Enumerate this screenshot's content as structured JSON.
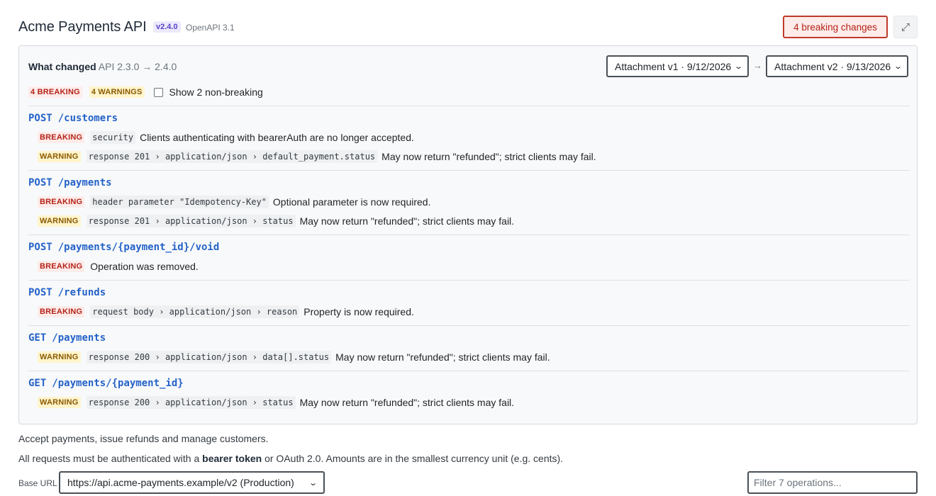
{
  "header": {
    "title": "Acme Payments API",
    "version": "v2.4.0",
    "spec": "OpenAPI 3.1",
    "breaking_button": "4 breaking changes",
    "expand_icon": "expand-icon"
  },
  "diff": {
    "label": "What changed",
    "range": "API 2.3.0 → 2.4.0",
    "attachment_left": "Attachment v1 · 9/12/2026",
    "attachment_right": "Attachment v2 · 9/13/2026",
    "arrow": "→",
    "breaking_count": "4 BREAKING",
    "warning_count": "4 WARNINGS",
    "show_nonbreaking": "Show 2 non-breaking",
    "show_nonbreaking_checked": false,
    "operations": [
      {
        "method": "POST",
        "path": "/customers",
        "changes": [
          {
            "level": "BREAKING",
            "location": "security",
            "text": "Clients authenticating with bearerAuth are no longer accepted."
          },
          {
            "level": "WARNING",
            "location": "response 201 › application/json › default_payment.status",
            "text": "May now return \"refunded\"; strict clients may fail."
          }
        ]
      },
      {
        "method": "POST",
        "path": "/payments",
        "changes": [
          {
            "level": "BREAKING",
            "location": "header parameter \"Idempotency-Key\"",
            "text": "Optional parameter is now required."
          },
          {
            "level": "WARNING",
            "location": "response 201 › application/json › status",
            "text": "May now return \"refunded\"; strict clients may fail."
          }
        ]
      },
      {
        "method": "POST",
        "path": "/payments/{payment_id}/void",
        "changes": [
          {
            "level": "BREAKING",
            "location": "",
            "text": "Operation was removed."
          }
        ]
      },
      {
        "method": "POST",
        "path": "/refunds",
        "changes": [
          {
            "level": "BREAKING",
            "location": "request body › application/json › reason",
            "text": "Property is now required."
          }
        ]
      },
      {
        "method": "GET",
        "path": "/payments",
        "changes": [
          {
            "level": "WARNING",
            "location": "response 200 › application/json › data[].status",
            "text": "May now return \"refunded\"; strict clients may fail."
          }
        ]
      },
      {
        "method": "GET",
        "path": "/payments/{payment_id}",
        "changes": [
          {
            "level": "WARNING",
            "location": "response 200 › application/json › status",
            "text": "May now return \"refunded\"; strict clients may fail."
          }
        ]
      }
    ]
  },
  "info": {
    "summary": "Accept payments, issue refunds and manage customers.",
    "auth_prefix": "All requests must be authenticated with a ",
    "auth_bold": "bearer token",
    "auth_suffix": " or OAuth 2.0. Amounts are in the smallest currency unit (e.g. cents)."
  },
  "footer": {
    "base_url_label": "Base URL",
    "base_url_value": "https://api.acme-payments.example/v2 (Production)",
    "filter_placeholder": "Filter 7 operations..."
  },
  "colors": {
    "breaking": "#b42318",
    "warning": "#8a5a00",
    "link": "#2563c9",
    "version_badge": "#5a43c9"
  }
}
